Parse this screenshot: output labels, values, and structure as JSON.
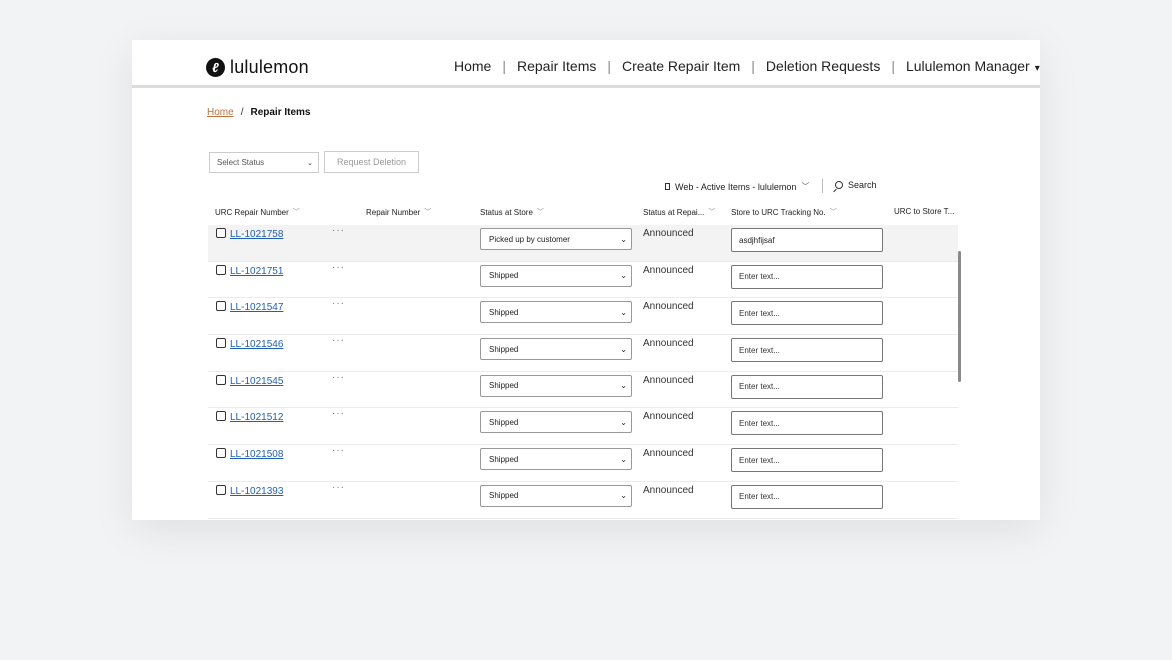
{
  "brand": {
    "name": "lululemon",
    "mark": "ℓ"
  },
  "nav": {
    "items": [
      "Home",
      "Repair Items",
      "Create Repair Item",
      "Deletion Requests"
    ],
    "user_menu": "Lululemon Manager"
  },
  "breadcrumb": {
    "home": "Home",
    "current": "Repair Items"
  },
  "controls": {
    "status_select": "Select Status",
    "request_deletion": "Request Deletion",
    "view_name": "Web - Active Items - lululemon",
    "search_label": "Search"
  },
  "table": {
    "columns": [
      "URC Repair Number",
      "Repair Number",
      "Status at Store",
      "Status at Repai...",
      "Store to URC Tracking No.",
      "URC to Store T..."
    ],
    "rows": [
      {
        "urc": "LL-1021758",
        "store_status": "Picked up by customer",
        "repair_status": "Announced",
        "tracking": "asdjhfijsaf"
      },
      {
        "urc": "LL-1021751",
        "store_status": "Shipped",
        "repair_status": "Announced",
        "tracking": "Enter text..."
      },
      {
        "urc": "LL-1021547",
        "store_status": "Shipped",
        "repair_status": "Announced",
        "tracking": "Enter text..."
      },
      {
        "urc": "LL-1021546",
        "store_status": "Shipped",
        "repair_status": "Announced",
        "tracking": "Enter text..."
      },
      {
        "urc": "LL-1021545",
        "store_status": "Shipped",
        "repair_status": "Announced",
        "tracking": "Enter text..."
      },
      {
        "urc": "LL-1021512",
        "store_status": "Shipped",
        "repair_status": "Announced",
        "tracking": "Enter text..."
      },
      {
        "urc": "LL-1021508",
        "store_status": "Shipped",
        "repair_status": "Announced",
        "tracking": "Enter text..."
      },
      {
        "urc": "LL-1021393",
        "store_status": "Shipped",
        "repair_status": "Announced",
        "tracking": "Enter text..."
      }
    ],
    "more_glyph": "···"
  },
  "colors": {
    "link": "#1f5fb5",
    "home_link": "#c0713a",
    "brand": "#111111"
  }
}
